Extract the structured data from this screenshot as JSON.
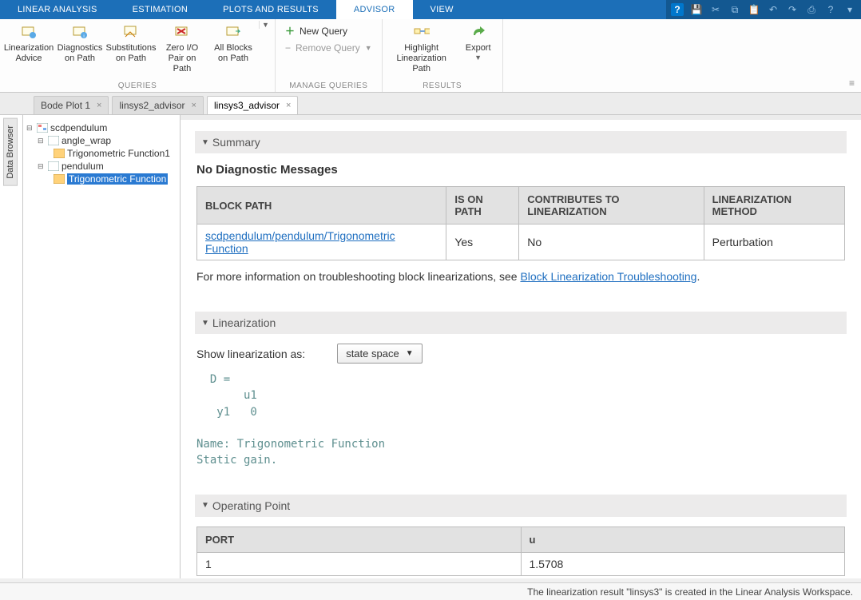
{
  "main_tabs": {
    "items": [
      "LINEAR ANALYSIS",
      "ESTIMATION",
      "PLOTS AND RESULTS",
      "ADVISOR",
      "VIEW"
    ],
    "active": "ADVISOR"
  },
  "toolstrip": {
    "queries": {
      "label": "QUERIES",
      "buttons": [
        {
          "label": "Linearization Advice"
        },
        {
          "label": "Diagnostics on Path"
        },
        {
          "label": "Substitutions on Path"
        },
        {
          "label": "Zero I/O Pair on Path"
        },
        {
          "label": "All Blocks on Path"
        }
      ]
    },
    "manage": {
      "label": "MANAGE QUERIES",
      "new_query": "New Query",
      "remove_query": "Remove Query"
    },
    "results": {
      "label": "RESULTS",
      "highlight": "Highlight Linearization Path",
      "export": "Export"
    }
  },
  "side_tab": "Data Browser",
  "doc_tabs": [
    {
      "label": "Bode Plot 1",
      "active": false
    },
    {
      "label": "linsys2_advisor",
      "active": false
    },
    {
      "label": "linsys3_advisor",
      "active": true
    }
  ],
  "tree": {
    "root": "scdpendulum",
    "n1": "angle_wrap",
    "n1a": "Trigonometric Function1",
    "n2": "pendulum",
    "n2a": "Trigonometric Function"
  },
  "summary": {
    "header": "Summary",
    "diag_title": "No Diagnostic Messages",
    "cols": [
      "BLOCK PATH",
      "IS ON PATH",
      "CONTRIBUTES TO LINEARIZATION",
      "LINEARIZATION METHOD"
    ],
    "row": {
      "path": "scdpendulum/pendulum/Trigonometric Function",
      "on_path": "Yes",
      "contributes": "No",
      "method": "Perturbation"
    },
    "info_pre": "For more information on troubleshooting block linearizations, see ",
    "info_link": "Block Linearization Troubleshooting",
    "info_post": "."
  },
  "linearization": {
    "header": "Linearization",
    "show_label": "Show linearization as:",
    "select_value": "state space",
    "body": "  D = \n       u1\n   y1   0\n\nName: Trigonometric Function\nStatic gain."
  },
  "operating_point": {
    "header": "Operating Point",
    "cols": [
      "PORT",
      "u"
    ],
    "row": {
      "port": "1",
      "u": "1.5708"
    }
  },
  "status": "The linearization result \"linsys3\" is created in the Linear Analysis Workspace."
}
